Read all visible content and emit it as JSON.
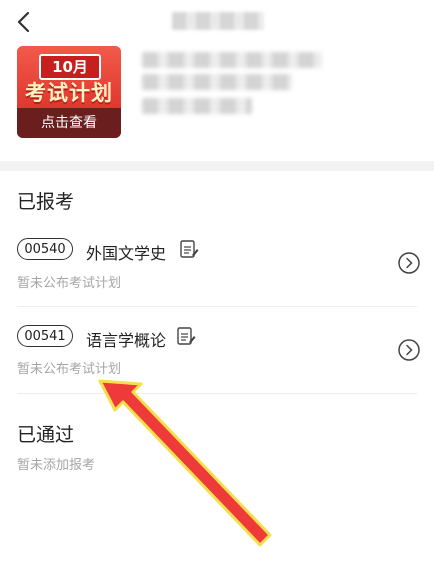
{
  "promo": {
    "month": "10月",
    "title": "考试计划",
    "cta": "点击查看"
  },
  "registered": {
    "title": "已报考",
    "courses": [
      {
        "code": "00540",
        "name": "外国文学史",
        "status": "暂未公布考试计划"
      },
      {
        "code": "00541",
        "name": "语言学概论",
        "status": "暂未公布考试计划"
      }
    ]
  },
  "passed": {
    "title": "已通过",
    "empty_text": "暂未添加报考"
  },
  "colors": {
    "arrow": "#ef3a3a",
    "arrow_outline": "#f4e04d",
    "muted_text": "#a6a6a6"
  }
}
